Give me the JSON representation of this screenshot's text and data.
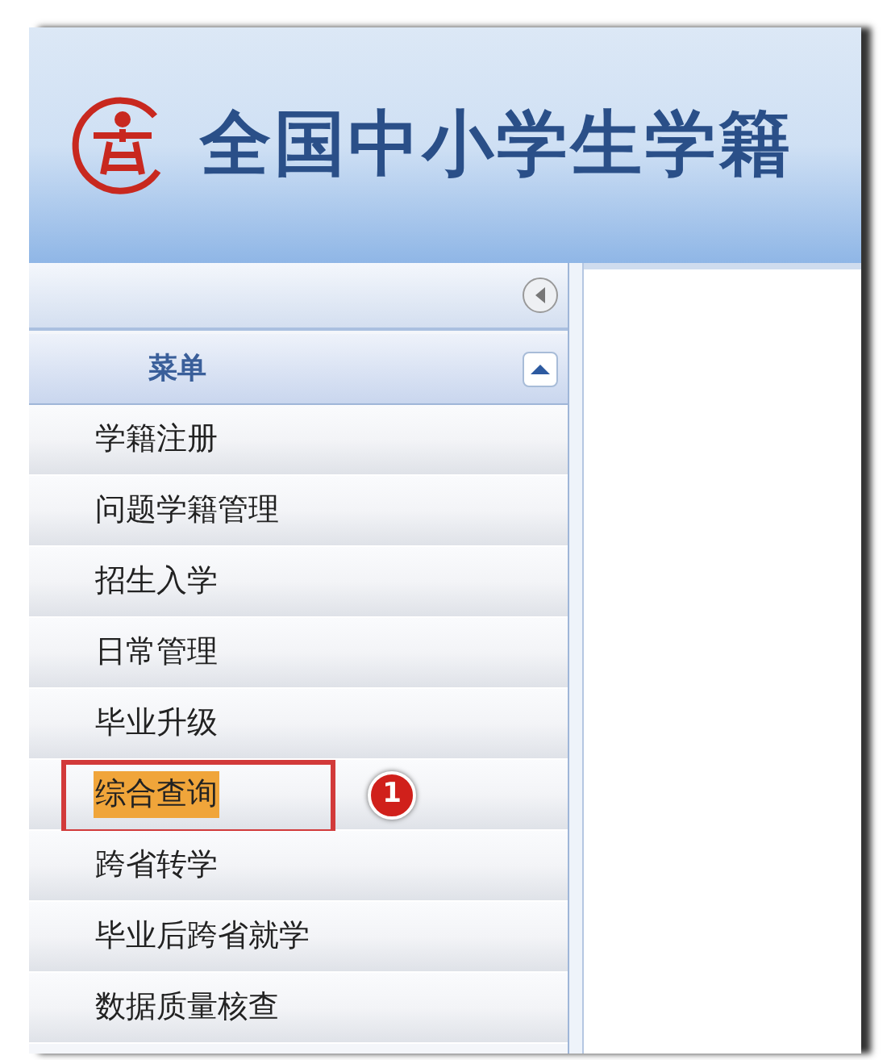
{
  "header": {
    "title": "全国中小学生学籍"
  },
  "menu": {
    "title": "菜单",
    "expanded": true,
    "items": [
      {
        "label": "学籍注册",
        "selected": false
      },
      {
        "label": "问题学籍管理",
        "selected": false
      },
      {
        "label": "招生入学",
        "selected": false
      },
      {
        "label": "日常管理",
        "selected": false
      },
      {
        "label": "毕业升级",
        "selected": false
      },
      {
        "label": "综合查询",
        "selected": true,
        "callout": "1"
      },
      {
        "label": "跨省转学",
        "selected": false
      },
      {
        "label": "毕业后跨省就学",
        "selected": false
      },
      {
        "label": "数据质量核查",
        "selected": false
      }
    ]
  }
}
